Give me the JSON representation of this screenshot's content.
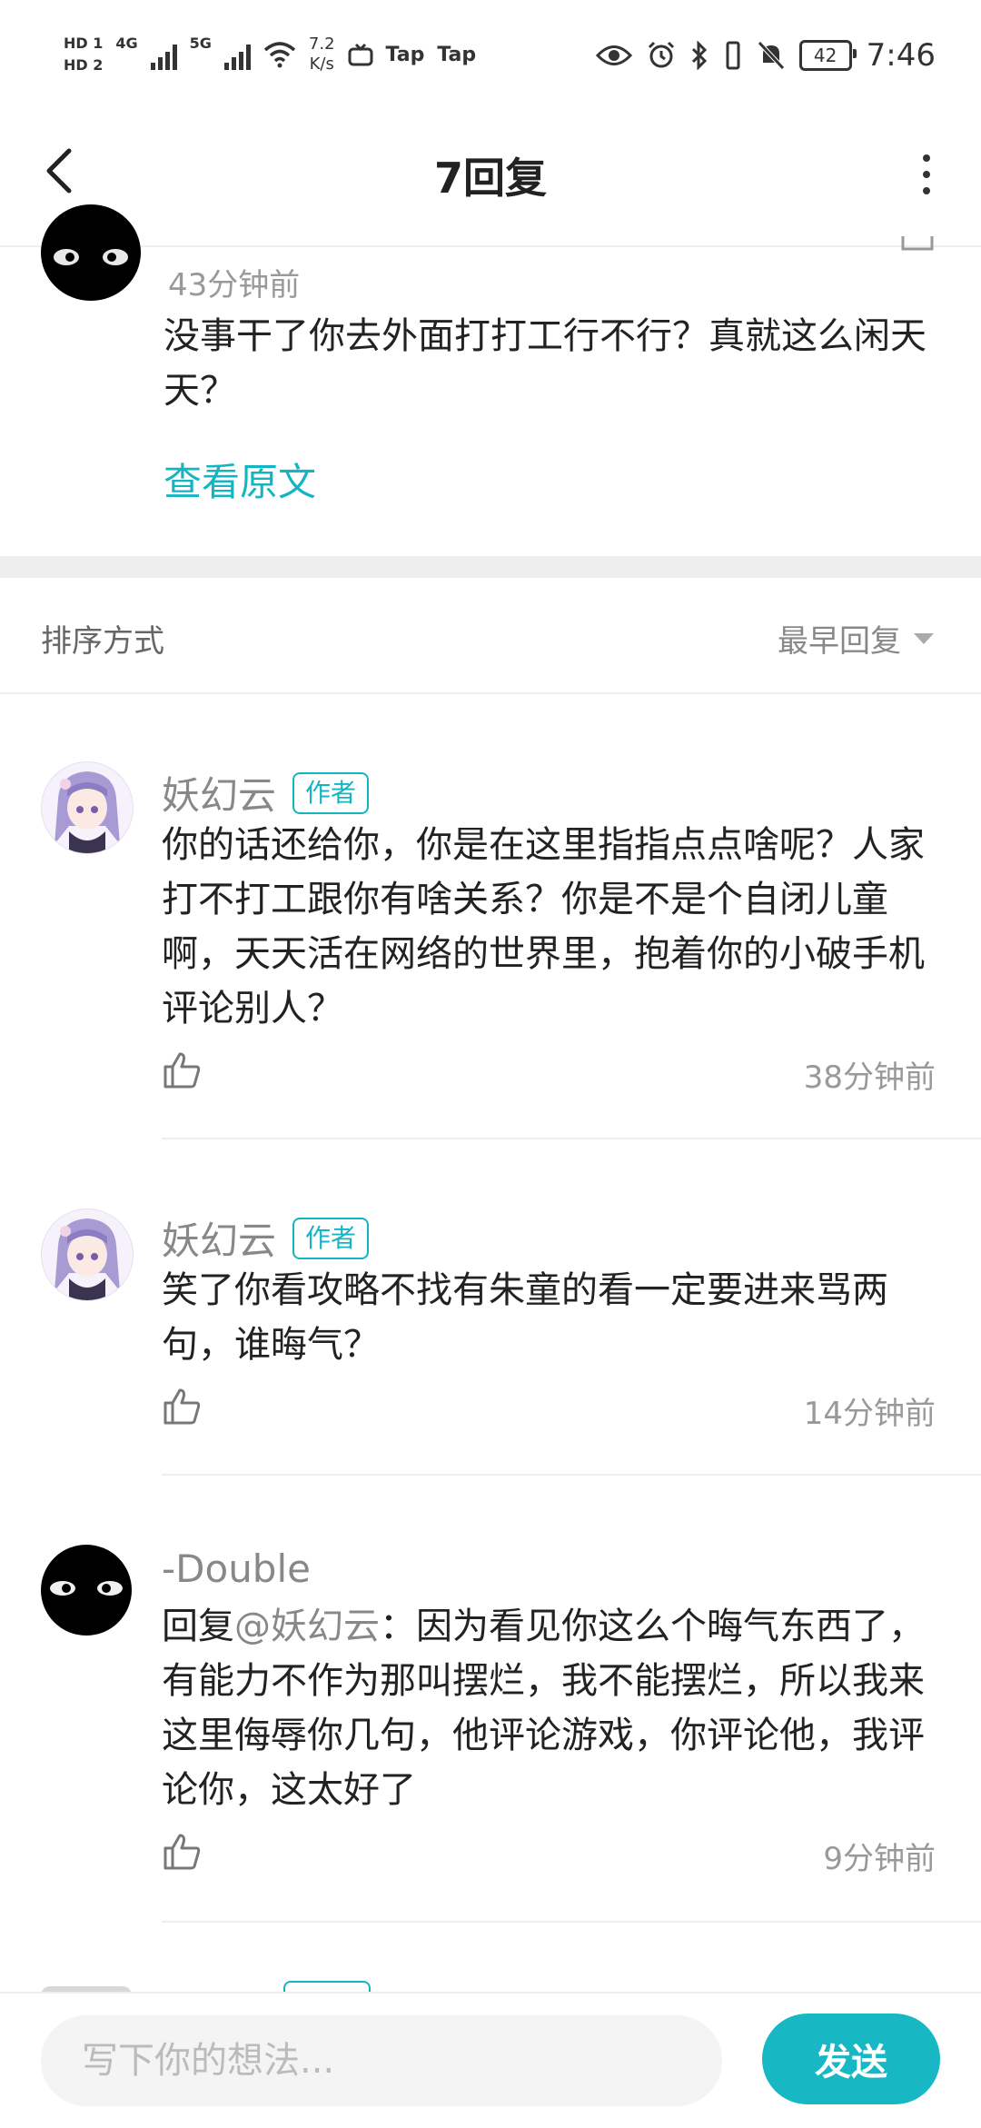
{
  "status_bar": {
    "hd1": "HD 1",
    "hd2": "HD 2",
    "net_4g": "4G",
    "net_5g": "5G",
    "speed_value": "7.2",
    "speed_unit": "K/s",
    "app1": "Tap",
    "app2": "Tap",
    "battery": "42",
    "time": "7:46"
  },
  "header": {
    "title": "7回复"
  },
  "original_comment": {
    "time": "43分钟前",
    "text": "没事干了你去外面打打工行不行？真就这么闲天天？",
    "view_original": "查看原文"
  },
  "sort": {
    "label": "排序方式",
    "value": "最早回复"
  },
  "replies": [
    {
      "username": "妖幻云",
      "badge": "作者",
      "text": "你的话还给你，你是在这里指指点点啥呢？人家打不打工跟你有啥关系？你是不是个自闭儿童啊，天天活在网络的世界里，抱着你的小破手机评论别人？",
      "time": "38分钟前"
    },
    {
      "username": "妖幻云",
      "badge": "作者",
      "text": "笑了你看攻略不找有朱童的看一定要进来骂两句，谁晦气？",
      "time": "14分钟前"
    },
    {
      "username": "-Double",
      "reply_prefix": "回复",
      "mention": "@妖幻云",
      "text": "：因为看见你这么个晦气东西了，有能力不作为那叫摆烂，我不能摆烂，所以我来这里侮辱你几句，他评论游戏，你评论他，我评论你，这太好了",
      "time": "9分钟前"
    }
  ],
  "composer": {
    "placeholder": "写下你的想法...",
    "send_label": "发送"
  },
  "colors": {
    "accent": "#14b5c3",
    "send_bg": "#17b8c4",
    "divider": "#eeeeee"
  }
}
